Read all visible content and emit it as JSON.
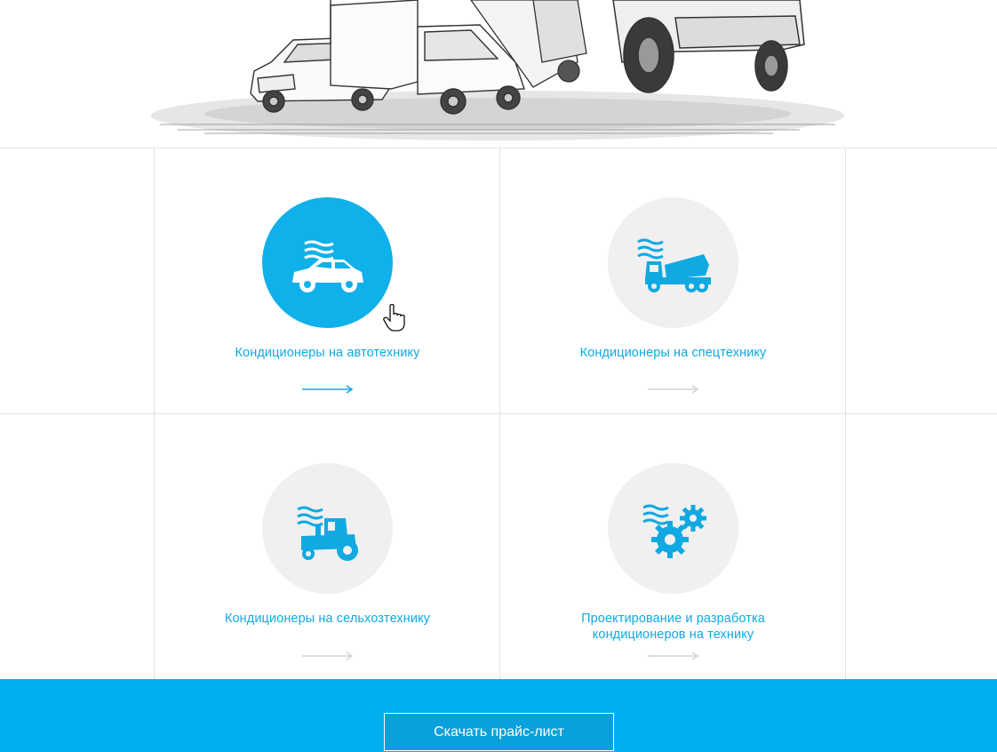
{
  "hero": {
    "image_description_icon": "vehicles-sketch-illustration"
  },
  "cards": [
    {
      "title": "Кондиционеры на автотехнику",
      "icon": "car-icon",
      "active": true
    },
    {
      "title": "Кондиционеры на спецтехнику",
      "icon": "concrete-mixer-truck-icon",
      "active": false
    },
    {
      "title": "Кондиционеры на сельхозтехнику",
      "icon": "tractor-icon",
      "active": false
    },
    {
      "title_line1": "Проектирование и разработка",
      "title_line2": "кондиционеров на технику",
      "icon": "gears-icon",
      "active": false
    }
  ],
  "footer": {
    "download_label": "Скачать прайс-лист"
  },
  "colors": {
    "accent": "#10b0ea",
    "footer": "#00b0ee",
    "circle_inactive": "#f0f0f0",
    "border": "#e3e3e3"
  }
}
